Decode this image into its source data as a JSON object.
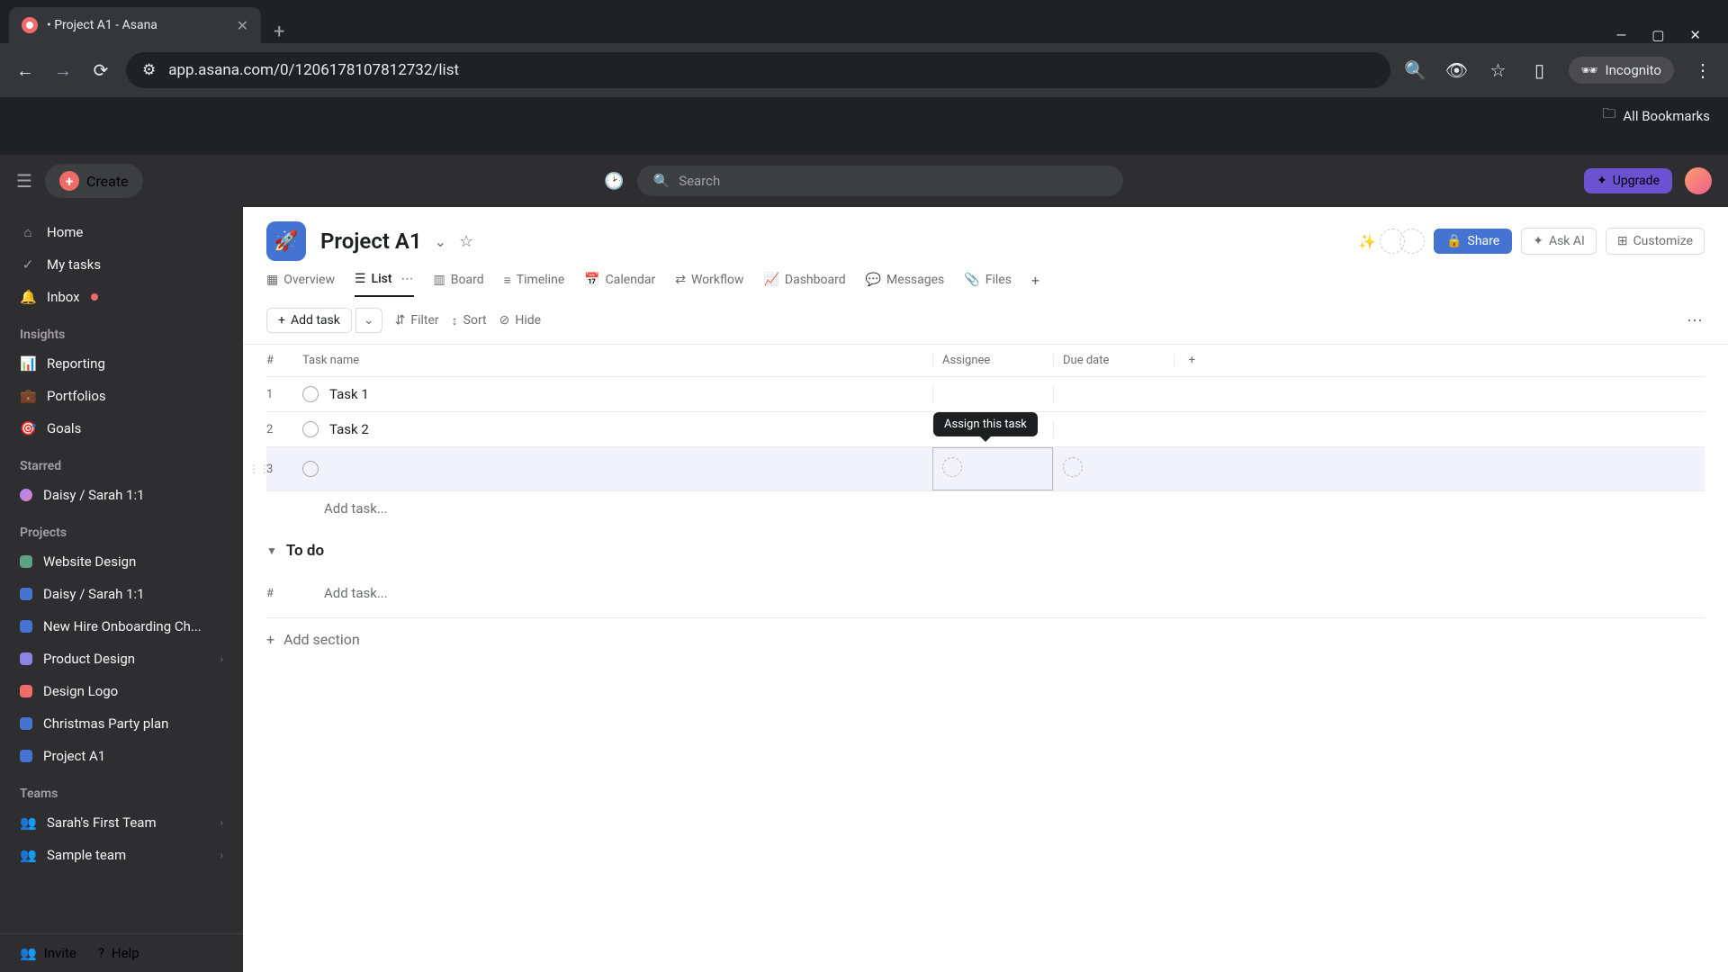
{
  "browser": {
    "tab_title": "• Project A1 - Asana",
    "url": "app.asana.com/0/1206178107812732/list",
    "incognito": "Incognito",
    "all_bookmarks": "All Bookmarks"
  },
  "topbar": {
    "create": "Create",
    "search_placeholder": "Search",
    "upgrade": "Upgrade"
  },
  "sidebar": {
    "home": "Home",
    "my_tasks": "My tasks",
    "inbox": "Inbox",
    "insights_head": "Insights",
    "reporting": "Reporting",
    "portfolios": "Portfolios",
    "goals": "Goals",
    "starred_head": "Starred",
    "starred_item": "Daisy / Sarah 1:1",
    "projects_head": "Projects",
    "projects": [
      {
        "name": "Website Design",
        "color": "#5da283"
      },
      {
        "name": "Daisy / Sarah 1:1",
        "color": "#4573d2"
      },
      {
        "name": "New Hire Onboarding Ch...",
        "color": "#4573d2"
      },
      {
        "name": "Product Design",
        "color": "#8d84e8"
      },
      {
        "name": "Design Logo",
        "color": "#f06a6a"
      },
      {
        "name": "Christmas Party plan",
        "color": "#4573d2"
      },
      {
        "name": "Project A1",
        "color": "#4573d2"
      }
    ],
    "teams_head": "Teams",
    "teams": [
      {
        "name": "Sarah's First Team"
      },
      {
        "name": "Sample team"
      }
    ],
    "invite": "Invite",
    "help": "Help"
  },
  "project": {
    "name": "Project A1",
    "share": "Share",
    "ask_ai": "Ask AI",
    "customize": "Customize",
    "tabs": {
      "overview": "Overview",
      "list": "List",
      "board": "Board",
      "timeline": "Timeline",
      "calendar": "Calendar",
      "workflow": "Workflow",
      "dashboard": "Dashboard",
      "messages": "Messages",
      "files": "Files"
    },
    "toolbar": {
      "add_task": "Add task",
      "filter": "Filter",
      "sort": "Sort",
      "hide": "Hide"
    },
    "columns": {
      "num": "#",
      "name": "Task name",
      "assignee": "Assignee",
      "due": "Due date"
    },
    "tasks": [
      {
        "num": "1",
        "name": "Task 1"
      },
      {
        "num": "2",
        "name": "Task 2"
      },
      {
        "num": "3",
        "name": ""
      }
    ],
    "add_task_placeholder": "Add task...",
    "tooltip": "Assign this task",
    "section_todo": "To do",
    "add_section": "Add section"
  }
}
